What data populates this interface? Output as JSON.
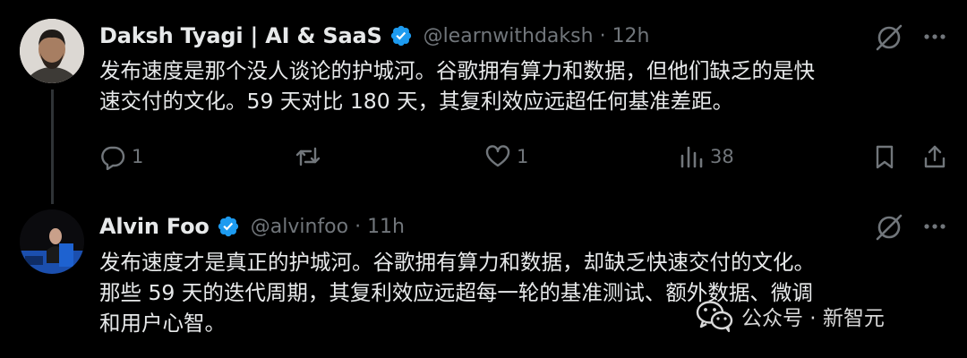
{
  "tweets": [
    {
      "author_name": "Daksh Tyagi | AI & SaaS",
      "handle": "@learnwithdaksh",
      "separator": "·",
      "time": "12h",
      "text_lines": [
        "发布速度是那个没人谈论的护城河。谷歌拥有算力和数据，但他们缺乏的是快",
        "速交付的文化。59 天对比 180 天，其复利效应远超任何基准差距。"
      ],
      "replies": "1",
      "reposts": "",
      "likes": "1",
      "views": "38"
    },
    {
      "author_name": "Alvin Foo",
      "handle": "@alvinfoo",
      "separator": "·",
      "time": "11h",
      "text_lines": [
        "发布速度才是真正的护城河。谷歌拥有算力和数据，却缺乏快速交付的文化。",
        "那些 59 天的迭代周期，其复利效应远超每一轮的基准测试、额外数据、微调",
        "和用户心智。"
      ]
    }
  ],
  "watermark": {
    "text": "公众号 · 新智元",
    "icon": "wechat-icon"
  },
  "colors": {
    "background": "#000000",
    "text": "#e7e9ea",
    "muted": "#71767b",
    "verified": "#1d9bf0",
    "thread_line": "#2f3336"
  }
}
